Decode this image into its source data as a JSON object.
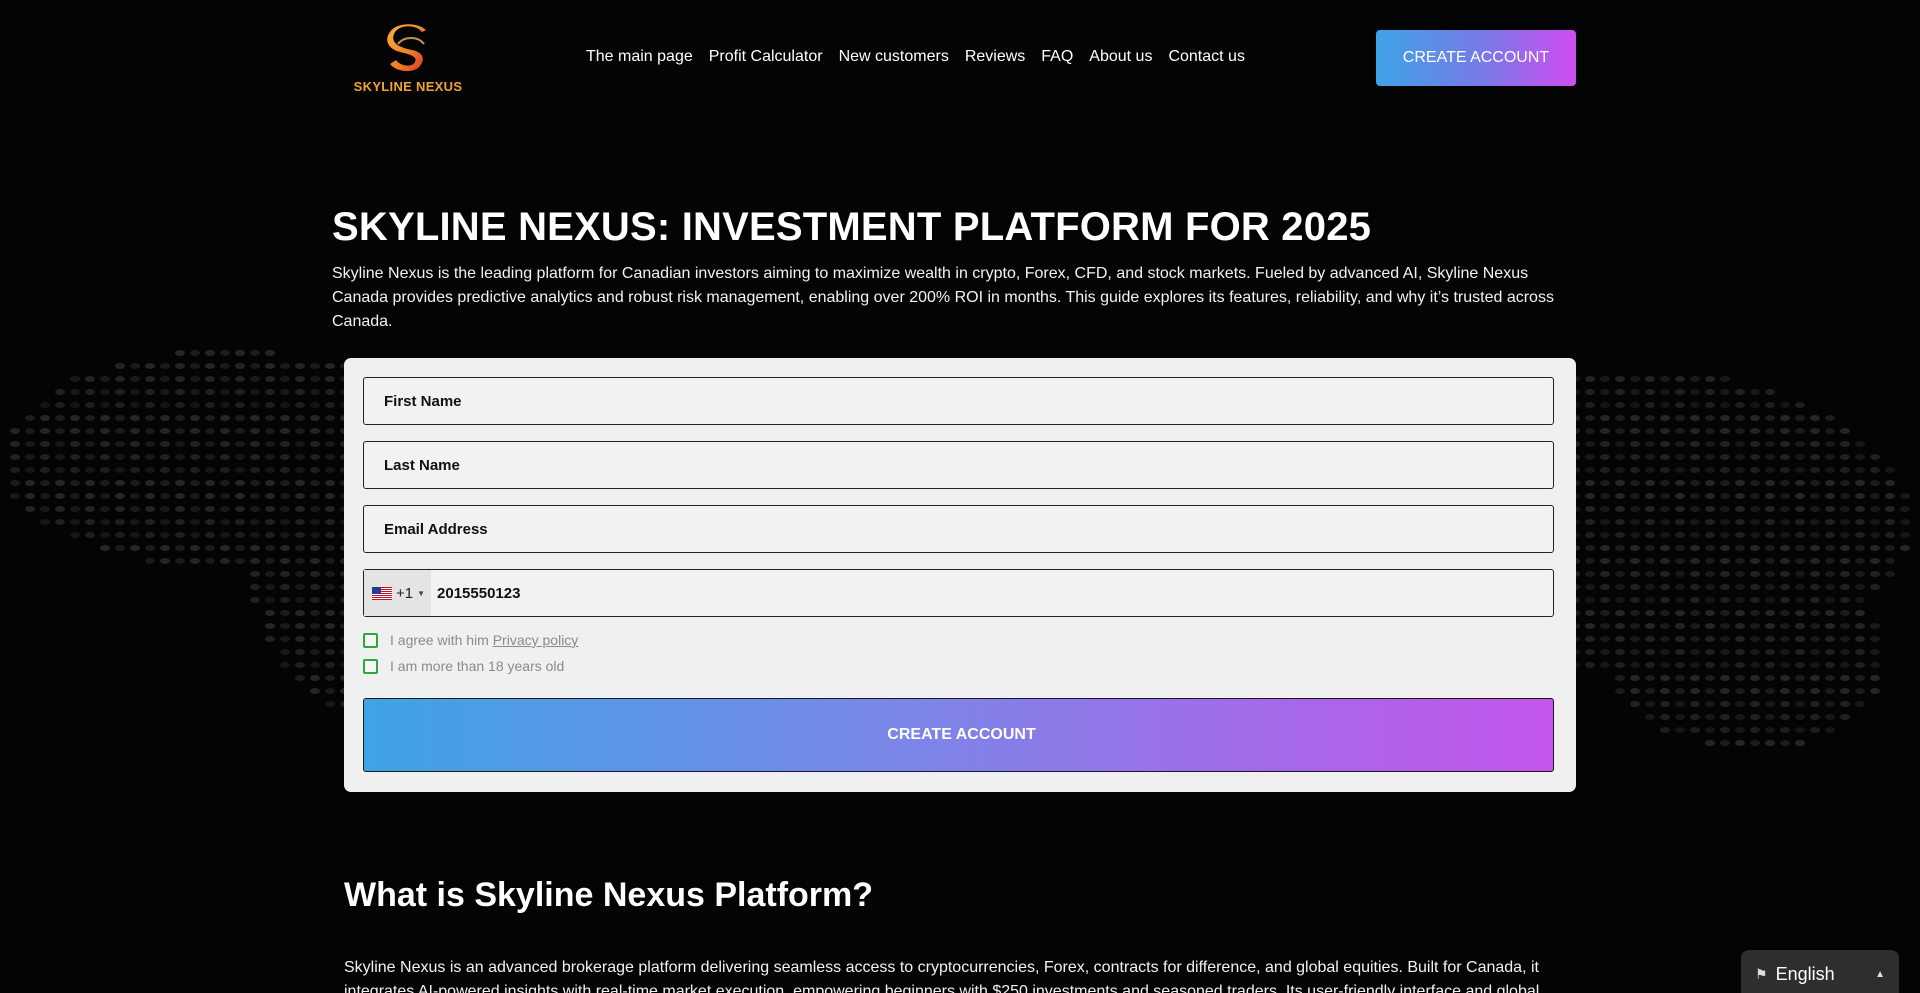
{
  "header": {
    "logo_text": "SKYLINE NEXUS",
    "nav": [
      {
        "label": "The main page"
      },
      {
        "label": "Profit Calculator"
      },
      {
        "label": "New customers"
      },
      {
        "label": "Reviews"
      },
      {
        "label": "FAQ"
      },
      {
        "label": "About us"
      },
      {
        "label": "Contact us"
      }
    ],
    "cta_label": "CREATE ACCOUNT"
  },
  "hero": {
    "title": "SKYLINE NEXUS: INVESTMENT PLATFORM FOR 2025",
    "description": "Skyline Nexus is the leading platform for Canadian investors aiming to maximize wealth in crypto, Forex, CFD, and stock markets. Fueled by advanced AI, Skyline Nexus Canada provides predictive analytics and robust risk management, enabling over 200% ROI in months. This guide explores its features, reliability, and why it’s trusted across Canada."
  },
  "form": {
    "first_name_placeholder": "First Name",
    "last_name_placeholder": "Last Name",
    "email_placeholder": "Email Address",
    "phone": {
      "dial_code": "+1",
      "value": "2015550123"
    },
    "checkboxes": {
      "privacy_prefix": "I agree with him",
      "privacy_link": "Privacy policy",
      "age_label": "I am more than 18 years old"
    },
    "submit_label": "CREATE ACCOUNT",
    "submit_icon": "user-plus-icon"
  },
  "section": {
    "title": "What is Skyline Nexus Platform?",
    "text": "Skyline Nexus is an advanced brokerage platform delivering seamless access to cryptocurrencies, Forex, contracts for difference, and global equities. Built for Canada, it integrates AI-powered insights with real-time market execution, empowering beginners with $250 investments and seasoned traders. Its user-friendly interface and global"
  },
  "language": {
    "label": "English",
    "icon": "flag-icon"
  },
  "colors": {
    "background": "#040404",
    "gradient_start": "#3ea3e6",
    "gradient_end": "#d04cf0",
    "logo_orange": "#f0a434",
    "checkbox_green": "#2daa3f"
  }
}
